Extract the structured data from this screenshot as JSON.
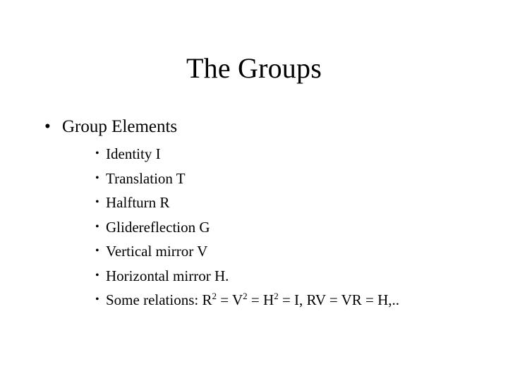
{
  "slide": {
    "title": "The Groups",
    "bullet_glyph": "•",
    "text_color": "#000000",
    "background_color": "#ffffff",
    "level1": [
      {
        "label": "Group Elements",
        "children": [
          {
            "label": "Identity I"
          },
          {
            "label": "Translation T"
          },
          {
            "label": "Halfturn R"
          },
          {
            "label": "Glidereflection  G"
          },
          {
            "label": "Vertical mirror V"
          },
          {
            "label": "Horizontal mirror H."
          }
        ],
        "relations": {
          "prefix": "Some relations: R",
          "sup1": "2",
          "mid1": " = V",
          "sup2": "2",
          "mid2": " = H",
          "sup3": "2",
          "suffix": " = I, RV = VR = H,..",
          "plain": "Some relations: R2 = V2 = H2 = I, RV = VR = H,.."
        }
      }
    ]
  }
}
